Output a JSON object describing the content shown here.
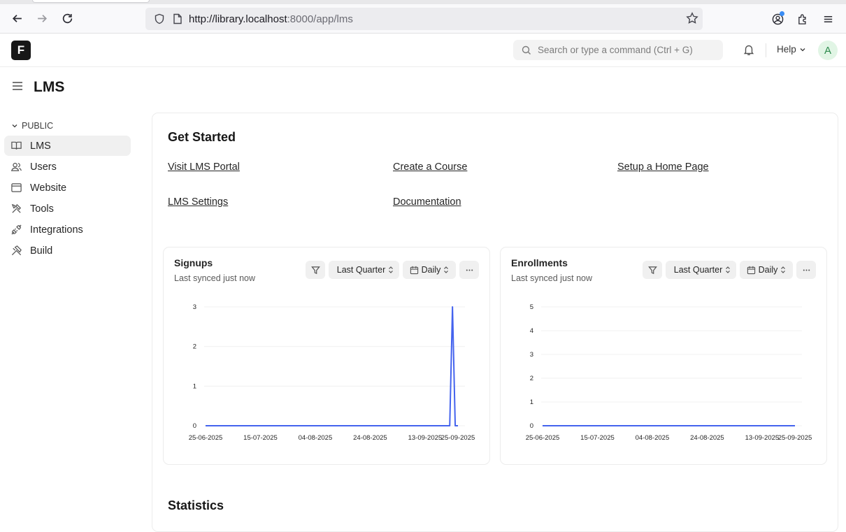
{
  "browser": {
    "url_host": "http://library.localhost",
    "url_port_path": ":8000/app/lms"
  },
  "navbar": {
    "logo_letter": "F",
    "search_placeholder": "Search or type a command (Ctrl + G)",
    "help_label": "Help",
    "avatar_letter": "A"
  },
  "page": {
    "title": "LMS"
  },
  "sidebar": {
    "section_label": "PUBLIC",
    "items": [
      {
        "label": "LMS",
        "icon": "book-icon"
      },
      {
        "label": "Users",
        "icon": "users-icon"
      },
      {
        "label": "Website",
        "icon": "browser-icon"
      },
      {
        "label": "Tools",
        "icon": "tools-icon"
      },
      {
        "label": "Integrations",
        "icon": "plug-icon"
      },
      {
        "label": "Build",
        "icon": "hammer-icon"
      }
    ]
  },
  "get_started": {
    "title": "Get Started",
    "links": [
      "Visit LMS Portal",
      "Create a Course",
      "Setup a Home Page",
      "LMS Settings",
      "Documentation"
    ]
  },
  "charts": [
    {
      "title": "Signups",
      "subtitle": "Last synced just now",
      "range": "Last Quarter",
      "interval": "Daily"
    },
    {
      "title": "Enrollments",
      "subtitle": "Last synced just now",
      "range": "Last Quarter",
      "interval": "Daily"
    }
  ],
  "statistics": {
    "title": "Statistics"
  },
  "chart_data": [
    {
      "type": "line",
      "title": "Signups",
      "x_tick_labels": [
        "25-06-2025",
        "15-07-2025",
        "04-08-2025",
        "24-08-2025",
        "13-09-2025",
        "25-09-2025"
      ],
      "y_ticks": [
        0,
        1,
        2,
        3
      ],
      "ylim": [
        0,
        3
      ],
      "series": [
        {
          "x": [
            "25-06-2025",
            "22-09-2025",
            "23-09-2025",
            "24-09-2025",
            "25-09-2025"
          ],
          "values": [
            0,
            0,
            3,
            0,
            0
          ]
        }
      ],
      "grid": true,
      "color": "#4463ee"
    },
    {
      "type": "line",
      "title": "Enrollments",
      "x_tick_labels": [
        "25-06-2025",
        "15-07-2025",
        "04-08-2025",
        "24-08-2025",
        "13-09-2025",
        "25-09-2025"
      ],
      "y_ticks": [
        0,
        1,
        2,
        3,
        4,
        5
      ],
      "ylim": [
        0,
        5
      ],
      "series": [
        {
          "x": [
            "25-06-2025",
            "25-09-2025"
          ],
          "values": [
            0,
            0
          ]
        }
      ],
      "grid": true,
      "color": "#4463ee"
    }
  ]
}
